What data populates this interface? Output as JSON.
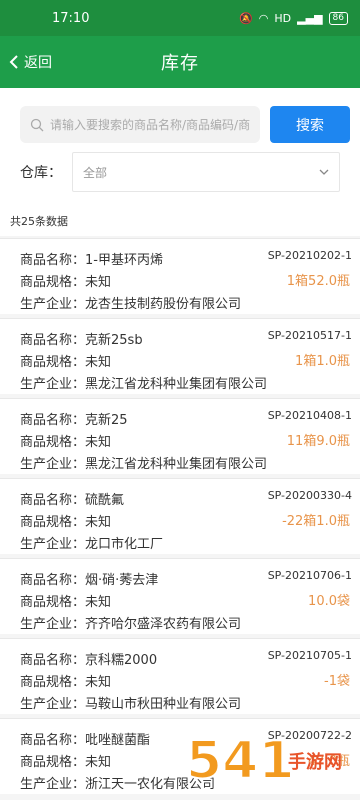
{
  "status": {
    "time": "17:10",
    "network": "HD",
    "battery": "86"
  },
  "header": {
    "back_label": "返回",
    "title": "库存"
  },
  "search": {
    "placeholder": "请输入要搜索的商品名称/商品编码/商",
    "button_label": "搜索"
  },
  "filter": {
    "warehouse_label": "仓库：",
    "warehouse_value": "全部"
  },
  "summary": "共25条数据",
  "colors": {
    "header": "#1e9e4a",
    "status": "#1e8e3e",
    "accent": "#1e86f0",
    "qty": "#e8944a"
  },
  "items": [
    {
      "name": "商品名称：1-甲基环丙烯",
      "code": "SP-20210202-1",
      "spec": "商品规格：未知",
      "qty": "1箱52.0瓶",
      "maker": "生产企业：龙杏生技制药股份有限公司"
    },
    {
      "name": "商品名称：克新25sb",
      "code": "SP-20210517-1",
      "spec": "商品规格：未知",
      "qty": "1箱1.0瓶",
      "maker": "生产企业：黑龙江省龙科种业集团有限公司"
    },
    {
      "name": "商品名称：克新25",
      "code": "SP-20210408-1",
      "spec": "商品规格：未知",
      "qty": "11箱9.0瓶",
      "maker": "生产企业：黑龙江省龙科种业集团有限公司"
    },
    {
      "name": "商品名称：硫酰氟",
      "code": "SP-20200330-4",
      "spec": "商品规格：未知",
      "qty": "-22箱1.0瓶",
      "maker": "生产企业：龙口市化工厂"
    },
    {
      "name": "商品名称：烟·硝·莠去津",
      "code": "SP-20210706-1",
      "spec": "商品规格：未知",
      "qty": "10.0袋",
      "maker": "生产企业：齐齐哈尔盛泽农药有限公司"
    },
    {
      "name": "商品名称：京科糯2000",
      "code": "SP-20210705-1",
      "spec": "商品规格：未知",
      "qty": "-1袋",
      "maker": "生产企业：马鞍山市秋田种业有限公司"
    },
    {
      "name": "商品名称：吡唑醚菌酯",
      "code": "SP-20200722-2",
      "spec": "商品规格：未知",
      "qty": "47.0瓶",
      "maker": "生产企业：浙江天一农化有限公司"
    }
  ],
  "watermark_text": "5419手游网"
}
